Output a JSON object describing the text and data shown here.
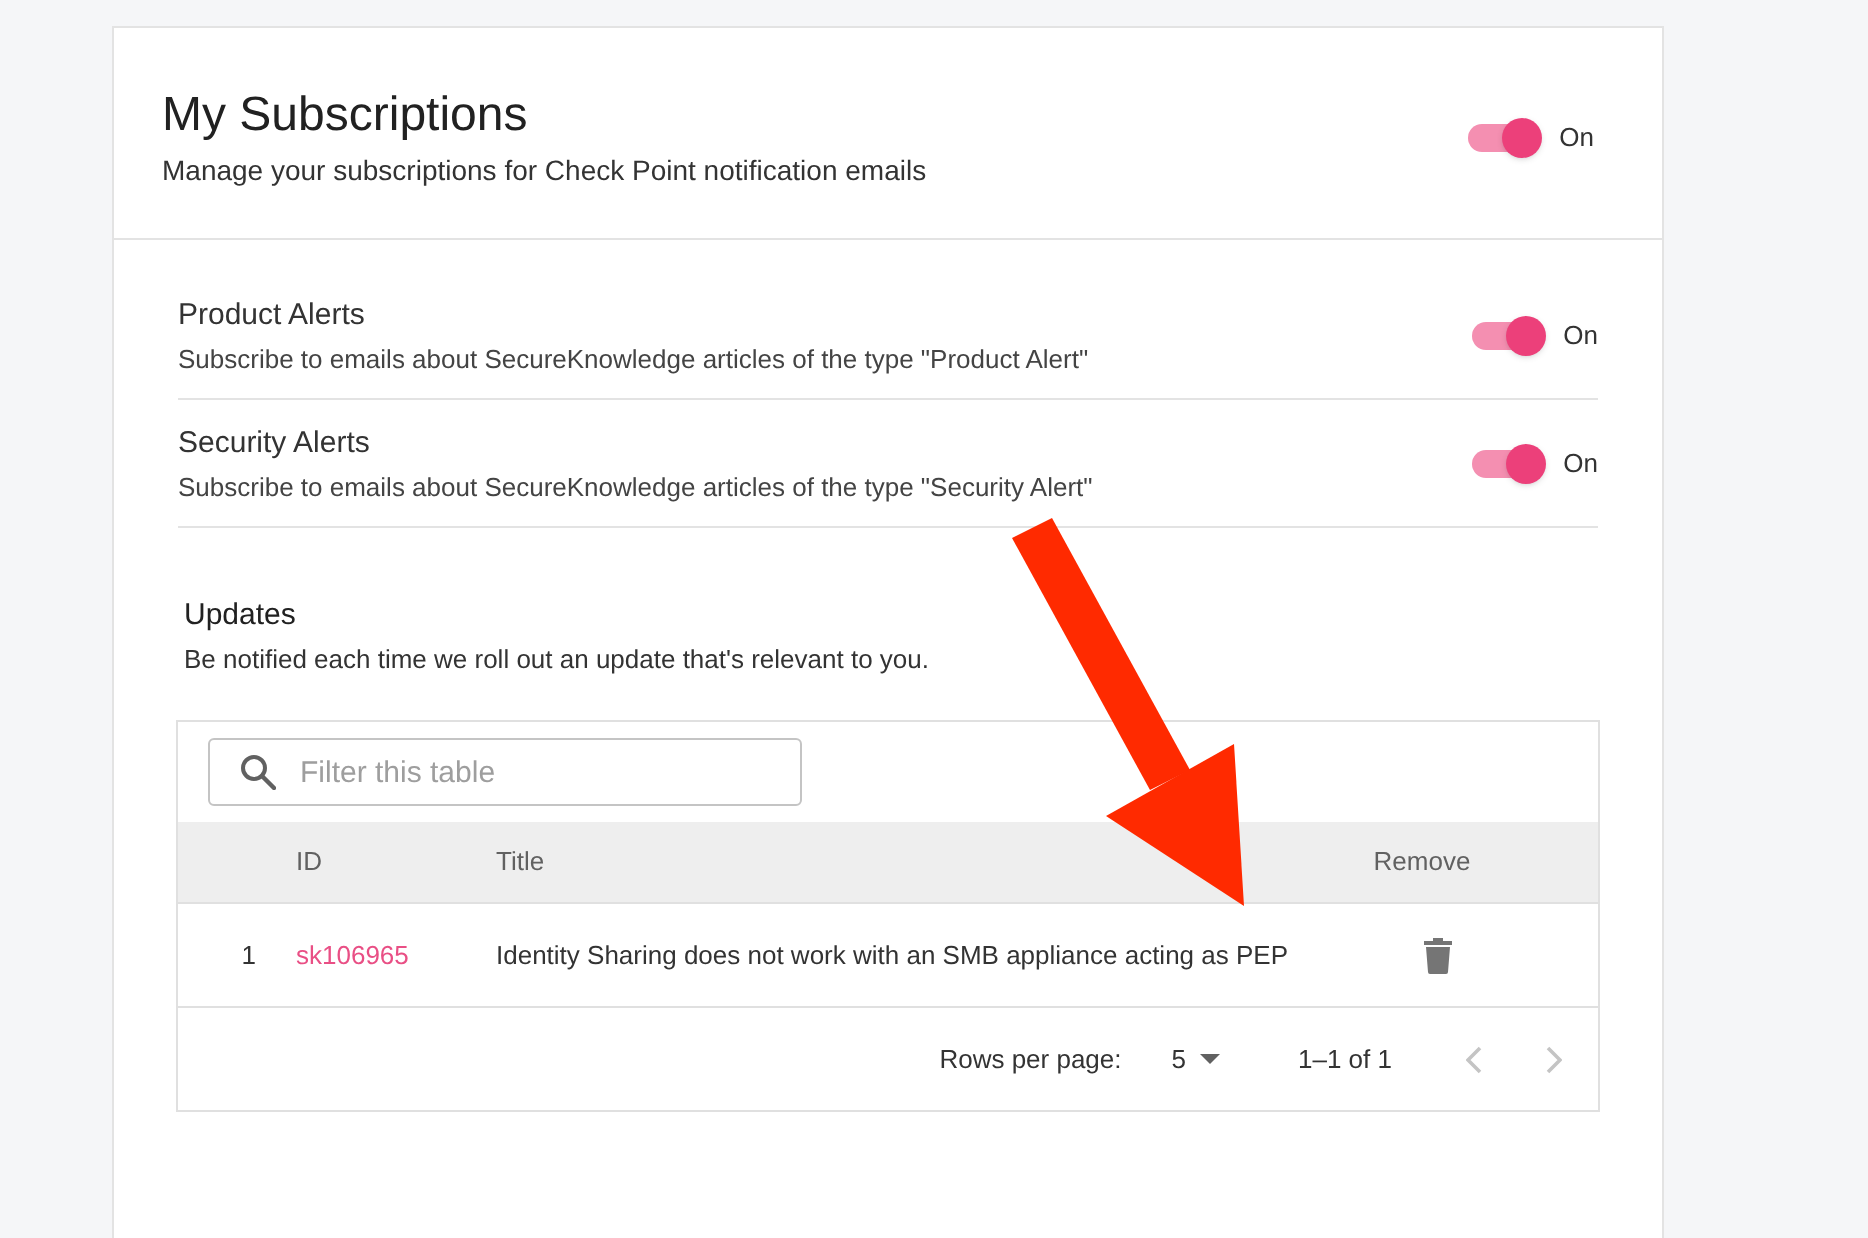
{
  "header": {
    "title": "My Subscriptions",
    "subtitle": "Manage your subscriptions for Check Point notification emails",
    "toggle": {
      "on": true,
      "label": "On"
    }
  },
  "subscriptions": [
    {
      "title": "Product Alerts",
      "description": "Subscribe to emails about SecureKnowledge articles of the type \"Product Alert\"",
      "toggle": {
        "on": true,
        "label": "On"
      }
    },
    {
      "title": "Security Alerts",
      "description": "Subscribe to emails about SecureKnowledge articles of the type \"Security Alert\"",
      "toggle": {
        "on": true,
        "label": "On"
      }
    }
  ],
  "updates": {
    "title": "Updates",
    "description": "Be notified each time we roll out an update that's relevant to you.",
    "filter": {
      "placeholder": "Filter this table"
    },
    "table": {
      "columns": [
        "ID",
        "Title",
        "Remove"
      ],
      "rows": [
        {
          "number": "1",
          "id": "sk106965",
          "title": "Identity Sharing does not work with an SMB appliance acting as PEP"
        }
      ]
    },
    "pagination": {
      "rows_per_page_label": "Rows per page:",
      "rows_per_page": "5",
      "range": "1–1 of 1",
      "previous": {
        "disabled": true
      },
      "next": {
        "disabled": true
      }
    }
  }
}
